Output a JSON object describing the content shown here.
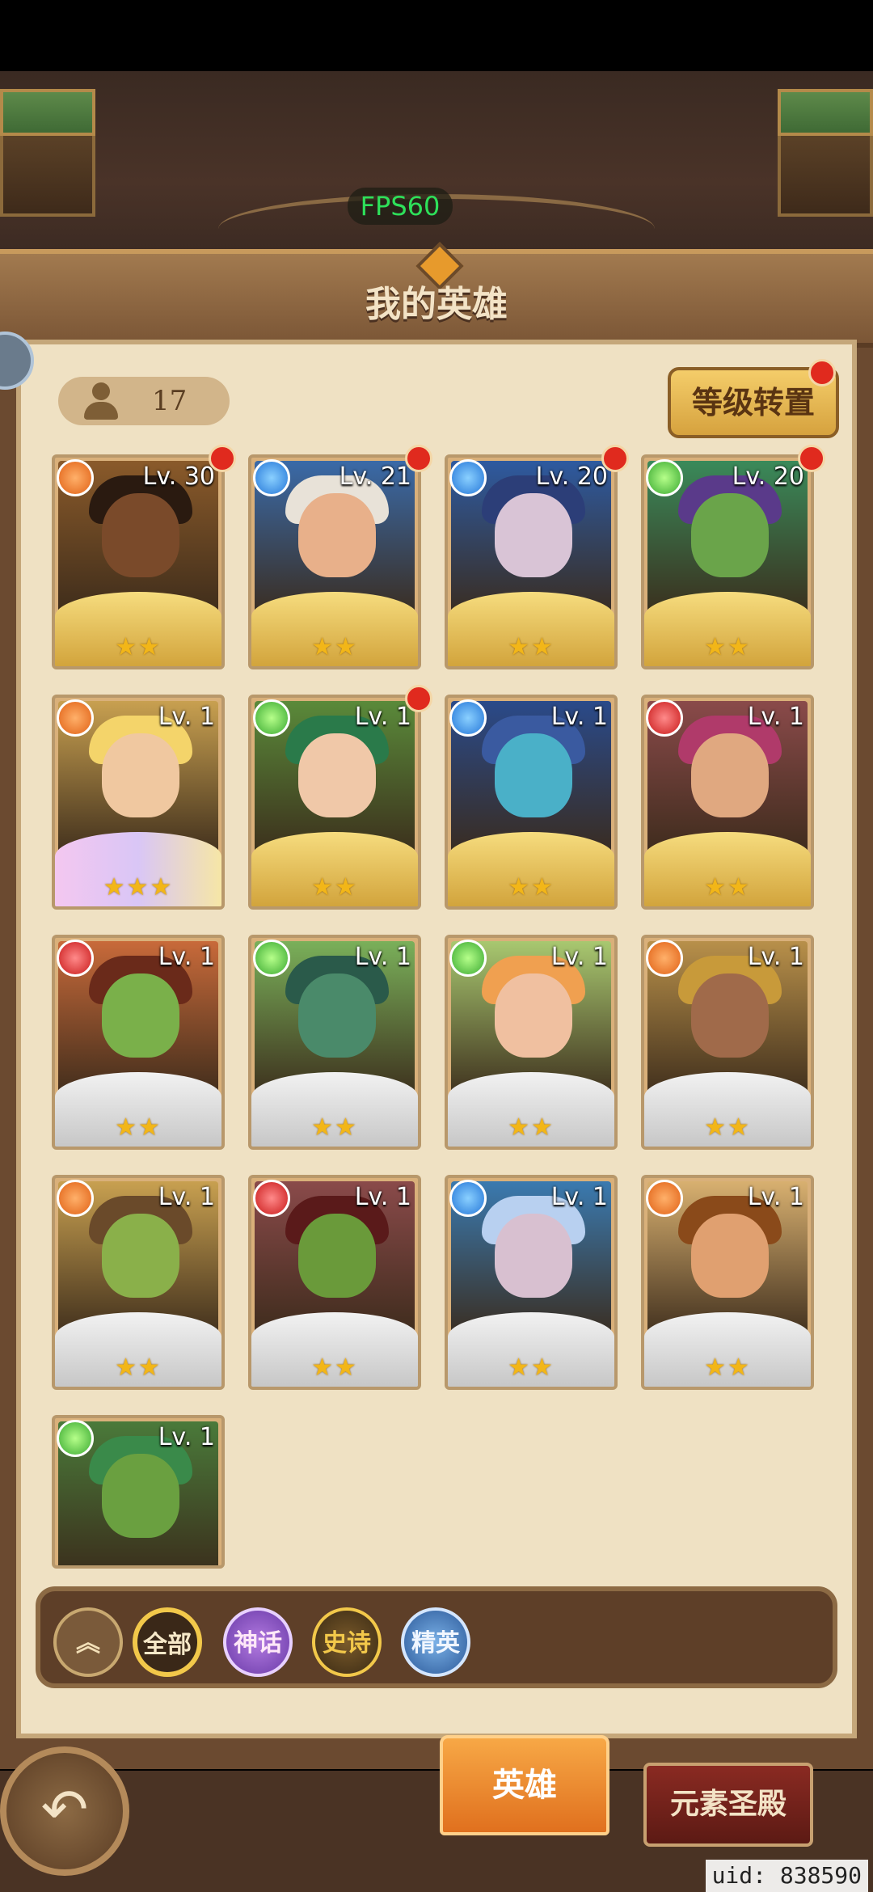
{
  "hud": {
    "fps_label": "FPS60"
  },
  "panel": {
    "title": "我的英雄"
  },
  "toolbar": {
    "hero_count": "17",
    "level_transfer_label": "等级转置"
  },
  "heroes": [
    {
      "level": "Lv. 30",
      "element": "fire",
      "stars": "★★",
      "frame": "gold",
      "red_dot": true,
      "skin": "#7a4a2a",
      "hair": "#2a1a10",
      "bg": "#8a5a2a"
    },
    {
      "level": "Lv. 21",
      "element": "water",
      "stars": "★★",
      "frame": "gold",
      "red_dot": true,
      "skin": "#e8b08a",
      "hair": "#e8e2d8",
      "bg": "#3a6aa8"
    },
    {
      "level": "Lv. 20",
      "element": "water",
      "stars": "★★",
      "frame": "gold",
      "red_dot": true,
      "skin": "#d9c4d6",
      "hair": "#2c3e78",
      "bg": "#2e5aa0"
    },
    {
      "level": "Lv. 20",
      "element": "nature",
      "stars": "★★",
      "frame": "gold",
      "red_dot": true,
      "skin": "#6aa44a",
      "hair": "#5a3a8a",
      "bg": "#3a8a5a"
    },
    {
      "level": "Lv. 1",
      "element": "fire",
      "stars": "★★★",
      "frame": "rainbow",
      "red_dot": false,
      "skin": "#f0c8a0",
      "hair": "#f4d46a",
      "bg": "#c8a050"
    },
    {
      "level": "Lv. 1",
      "element": "nature",
      "stars": "★★",
      "frame": "gold",
      "red_dot": true,
      "skin": "#f0c8a8",
      "hair": "#2a7a4a",
      "bg": "#5a8a3a"
    },
    {
      "level": "Lv. 1",
      "element": "water",
      "stars": "★★",
      "frame": "gold",
      "red_dot": false,
      "skin": "#4ab0c8",
      "hair": "#3a5aa0",
      "bg": "#2a4a8a"
    },
    {
      "level": "Lv. 1",
      "element": "blood",
      "stars": "★★",
      "frame": "gold",
      "red_dot": false,
      "skin": "#e0a880",
      "hair": "#b03a6a",
      "bg": "#8a4a4a"
    },
    {
      "level": "Lv. 1",
      "element": "blood",
      "stars": "★★",
      "frame": "silver",
      "red_dot": false,
      "skin": "#7ab04a",
      "hair": "#6a2a1a",
      "bg": "#c86a3a"
    },
    {
      "level": "Lv. 1",
      "element": "nature",
      "stars": "★★",
      "frame": "silver",
      "red_dot": false,
      "skin": "#4a8a6a",
      "hair": "#2a5a4a",
      "bg": "#7ab05a"
    },
    {
      "level": "Lv. 1",
      "element": "nature",
      "stars": "★★",
      "frame": "silver",
      "red_dot": false,
      "skin": "#f0c0a0",
      "hair": "#f0a050",
      "bg": "#a8c870"
    },
    {
      "level": "Lv. 1",
      "element": "fire",
      "stars": "★★",
      "frame": "silver",
      "red_dot": false,
      "skin": "#a06a4a",
      "hair": "#c89a3a",
      "bg": "#b8904a"
    },
    {
      "level": "Lv. 1",
      "element": "fire",
      "stars": "★★",
      "frame": "silver",
      "red_dot": false,
      "skin": "#8ab04a",
      "hair": "#6a4a2a",
      "bg": "#c8a050"
    },
    {
      "level": "Lv. 1",
      "element": "blood",
      "stars": "★★",
      "frame": "silver",
      "red_dot": false,
      "skin": "#6a9a3a",
      "hair": "#5a1a1a",
      "bg": "#8a4a4a"
    },
    {
      "level": "Lv. 1",
      "element": "water",
      "stars": "★★",
      "frame": "silver",
      "red_dot": false,
      "skin": "#d8c0d0",
      "hair": "#b8d0f0",
      "bg": "#3a7ab0"
    },
    {
      "level": "Lv. 1",
      "element": "fire",
      "stars": "★★",
      "frame": "silver",
      "red_dot": false,
      "skin": "#e0a070",
      "hair": "#8a4a1a",
      "bg": "#d8b070"
    },
    {
      "level": "Lv. 1",
      "element": "nature",
      "stars": "",
      "frame": "none",
      "red_dot": false,
      "skin": "#6aa040",
      "hair": "#3a8a4a",
      "bg": "#4a7a3a"
    }
  ],
  "filters": {
    "all": "全部",
    "mythic": "神话",
    "epic": "史诗",
    "elite": "精英"
  },
  "bottom_tabs": {
    "hero": "英雄",
    "element_temple": "元素圣殿"
  },
  "uid_label": "uid: 838590",
  "colors": {
    "accent": "#e0701e",
    "panel_bg": "#efe1c3",
    "red_dot": "#e02a1e"
  }
}
